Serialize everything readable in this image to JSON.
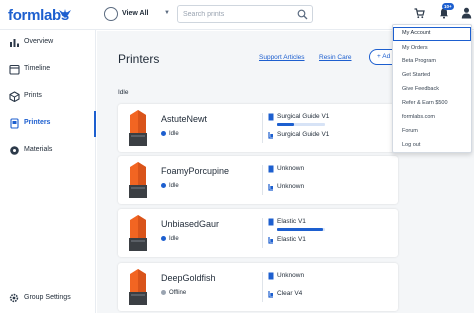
{
  "brand": {
    "name": "formlabs",
    "color": "#1d5fcf"
  },
  "topbar": {
    "view_all_label": "View All",
    "search_placeholder": "Search prints",
    "notifications_count": "10+"
  },
  "sidebar": {
    "items": [
      {
        "label": "Overview",
        "icon": "overview-icon",
        "active": false
      },
      {
        "label": "Timeline",
        "icon": "timeline-icon",
        "active": false
      },
      {
        "label": "Prints",
        "icon": "prints-icon",
        "active": false
      },
      {
        "label": "Printers",
        "icon": "printers-icon",
        "active": true
      },
      {
        "label": "Materials",
        "icon": "materials-icon",
        "active": false
      }
    ],
    "group_settings_label": "Group Settings"
  },
  "main": {
    "title": "Printers",
    "links": {
      "support_articles": "Support Articles",
      "resin_care": "Resin Care"
    },
    "add_button_label": "+ Ad",
    "section_label": "Idle",
    "printers": [
      {
        "name": "AstuteNewt",
        "status": "Idle",
        "status_color": "#1d5fcf",
        "tank": "Surgical Guide V1",
        "tank_level": 0.35,
        "cartridge": "Surgical Guide V1"
      },
      {
        "name": "FoamyPorcupine",
        "status": "Idle",
        "status_color": "#1d5fcf",
        "tank": "Unknown",
        "cartridge": "Unknown"
      },
      {
        "name": "UnbiasedGaur",
        "status": "Idle",
        "status_color": "#1d5fcf",
        "tank": "Elastic V1",
        "tank_level": 0.95,
        "cartridge": "Elastic V1"
      },
      {
        "name": "DeepGoldfish",
        "status": "Offline",
        "status_color": "#9aa4b1",
        "tank": "Unknown",
        "cartridge": "Clear V4"
      }
    ]
  },
  "user_menu": {
    "items": [
      "My Account",
      "My Orders",
      "Beta Program",
      "Get Started",
      "Give Feedback",
      "Refer & Earn $500",
      "formlabs.com",
      "Forum",
      "Log out"
    ],
    "selected": "My Account"
  }
}
